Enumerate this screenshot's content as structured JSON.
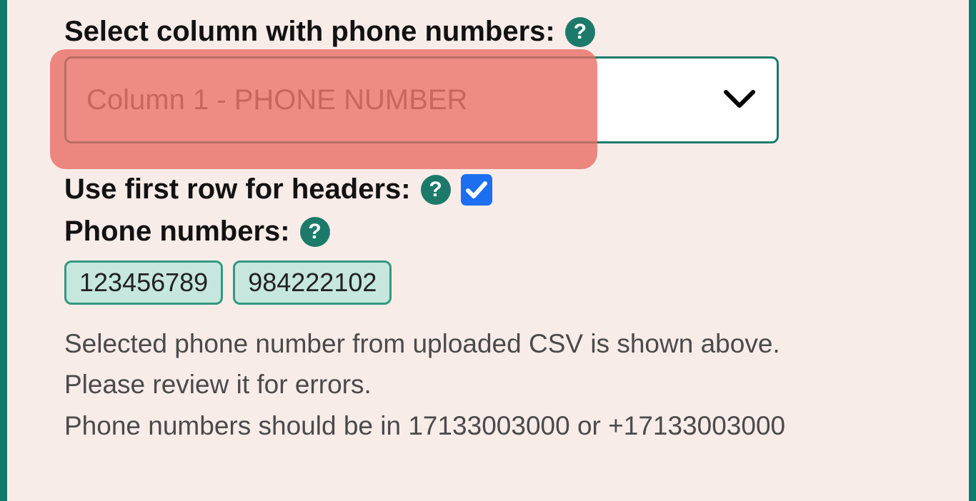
{
  "column_select": {
    "label": "Select column with phone numbers:",
    "value": "Column 1 - PHONE NUMBER"
  },
  "first_row_headers": {
    "label": "Use first row for headers:",
    "checked": true
  },
  "phone_numbers": {
    "label": "Phone numbers:",
    "values": [
      "123456789",
      "984222102"
    ]
  },
  "info": {
    "line1": "Selected phone number from uploaded CSV is shown above.",
    "line2": "Please review it for errors.",
    "line3": "Phone numbers should be in 17133003000 or +17133003000"
  },
  "icons": {
    "help": "?"
  }
}
